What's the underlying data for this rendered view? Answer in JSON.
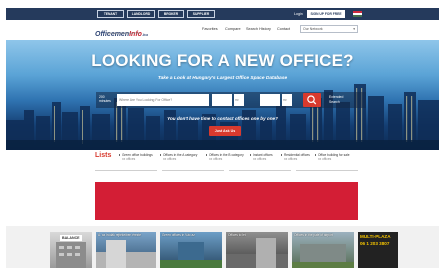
{
  "topbar": {
    "buttons": [
      "TENANT",
      "LANDLORD",
      "BROKER",
      "SUPPLIER"
    ],
    "login": "Login",
    "signup": "SIGN UP FOR FREE",
    "flag_colors": [
      "#cd2a3e",
      "#ffffff",
      "#436f4d"
    ]
  },
  "header": {
    "logo_part1": "Officemen",
    "logo_part2": "Info",
    "logo_suffix": ".hu",
    "logo_tagline": "Офисная Сервис Бизнеса Ваш",
    "nav": [
      "Favorites",
      "Compare",
      "Search History",
      "Contact"
    ],
    "network_select": "Our Network"
  },
  "hero": {
    "title": "LOOKING FOR A NEW OFFICE?",
    "subtitle": "Take a Look at Hungary's Largest Office Space Database",
    "search_minutes": "200 minutes",
    "search_placeholder": "Where Are You Looking For Office?",
    "box1": "",
    "box2": "m²",
    "box3": "",
    "box4": "m²",
    "extended_line1": "Extended",
    "extended_line2": "Search",
    "question": "You don't have time to contact offices one by one?",
    "ask_button": "Just Ask Us"
  },
  "lists": {
    "title": "Lists",
    "items": [
      {
        "label": "Green office buildings",
        "count": "xx offices"
      },
      {
        "label": "Offices in the A category",
        "count": "xx offices"
      },
      {
        "label": "Offices in the B category",
        "count": "xx offices"
      },
      {
        "label": "Instant offices",
        "count": "xx offices"
      },
      {
        "label": "Residential offices",
        "count": "xx offices"
      },
      {
        "label": "Office building for sale",
        "count": "xx offices"
      }
    ]
  },
  "banner_color": "#d31e35",
  "thumbnails": [
    {
      "caption": "",
      "badge": "BALANCE"
    },
    {
      "caption": "Á. az irodák rejtékeiben érezte",
      "badge": ""
    },
    {
      "caption": "Green offices in Vác az",
      "badge": ""
    },
    {
      "caption": "Offices to let",
      "badge": ""
    },
    {
      "caption": "Offices in the pale of airport",
      "badge": ""
    }
  ],
  "ad": {
    "title": "MULTI-PLAZA",
    "phone": "06 1 203 3807"
  }
}
